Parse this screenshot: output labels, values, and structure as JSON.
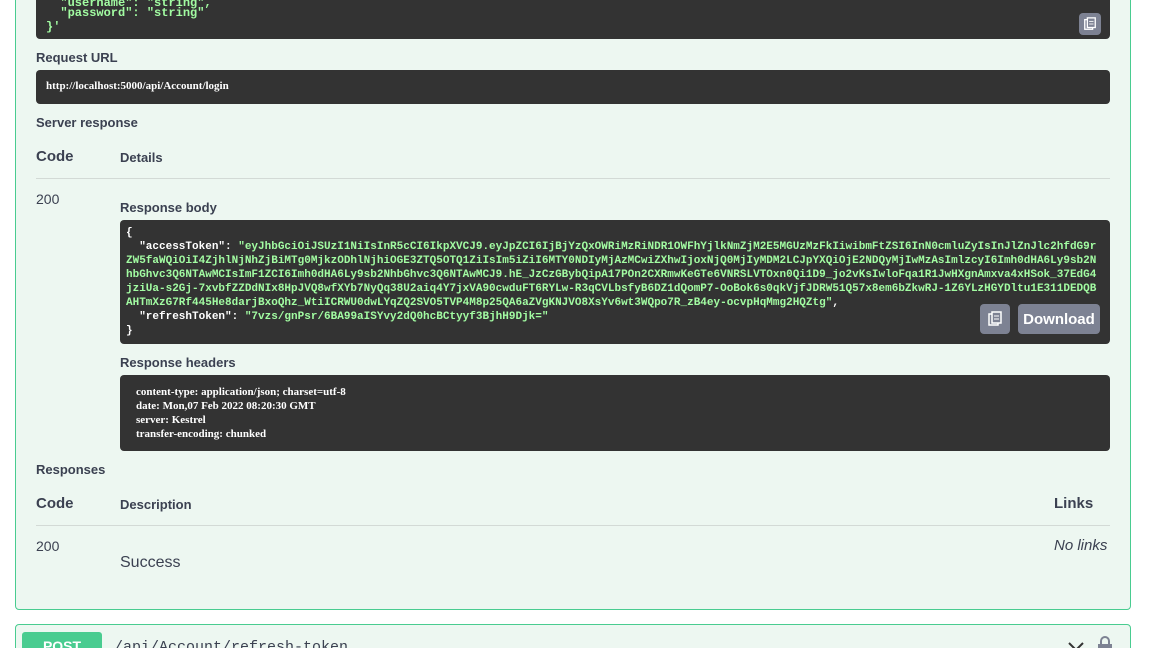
{
  "curl": {
    "line_username": "  \"username\": \"string\",",
    "line_password_key": "  \"password\": ",
    "line_password_val": "\"string\"",
    "line_close": "}'"
  },
  "request_url": {
    "title": "Request URL",
    "value": "http://localhost:5000/api/Account/login"
  },
  "server_response": {
    "title": "Server response",
    "col_code": "Code",
    "col_details": "Details",
    "code": "200",
    "body_title": "Response body",
    "body_open": "{",
    "access_key": "  \"accessToken\": ",
    "access_value": "\"eyJhbGciOiJSUzI1NiIsInR5cCI6IkpXVCJ9.eyJpZCI6IjBjYzQxOWRiMzRiNDR1OWFhYjlkNmZjM2E5MGUzMzFkIiwibmFtZSI6InN0cmluZyIsInJlZnJlc2hfdG9rZW5faWQiOiI4ZjhlNjNhZjBiMTg0MjkzODhlNjhiOGE3ZTQ5OTQ1ZiIsIm5iZiI6MTY0NDIyMjAzMCwiZXhwIjoxNjQ0MjIyMDM2LCJpYXQiOjE2NDQyMjIwMzAsImlzcyI6Imh0dHA6Ly9sb2NhbGhvc3Q6NTAwMCIsImF1ZCI6Imh0dHA6Ly9sb2NhbGhvc3Q6NTAwMCJ9.hE_JzCzGBybQipA17POn2CXRmwKeGTe6VNRSLVTOxn0Qi1D9_jo2vKsIwloFqa1R1JwHXgnAmxva4xHSok_37EdG4jziUa-s2Gj-7xvbfZZDdNIx8HpJVQ8wfXYb7NyQq38U2aiq4Y7jxVA90cwduFT6RYLw-R3qCVLbsfyB6DZ1dQomP7-OoBok6s0qkVjfJDRW51Q57x8em6bZkwRJ-1Z6YLzHGYDltu1E311DEDQBAHTmXzG7Rf445He8darjBxoQhz_WtiICRWU0dwLYqZQ2SVO5TVP4M8p25QA6aZVgKNJVO8XsYv6wt3WQpo7R_zB4ey-ocvpHqMmg2HQZtg\"",
    "access_comma": ",",
    "refresh_key": "  \"refreshToken\": ",
    "refresh_value": "\"7vzs/gnPsr/6BA99aISYvy2dQ0hcBCtyyf3BjhH9Djk=\"",
    "body_close": "}",
    "download_label": "Download",
    "headers_title": "Response headers",
    "headers": [
      "content-type: application/json; charset=utf-8",
      "date: Mon,07 Feb 2022 08:20:30 GMT",
      "server: Kestrel",
      "transfer-encoding: chunked"
    ]
  },
  "responses": {
    "title": "Responses",
    "col_code": "Code",
    "col_description": "Description",
    "col_links": "Links",
    "code": "200",
    "description": "Success",
    "links": "No links"
  },
  "next_operation": {
    "method": "POST",
    "path": "/api/Account/refresh-token"
  },
  "colors": {
    "post_accent": "#49cc90",
    "code_bg": "#333333",
    "string_color": "#a2fca2",
    "button_gray": "#7d8293"
  },
  "icons": [
    "copy-icon",
    "chevron-down-icon",
    "lock-icon"
  ]
}
